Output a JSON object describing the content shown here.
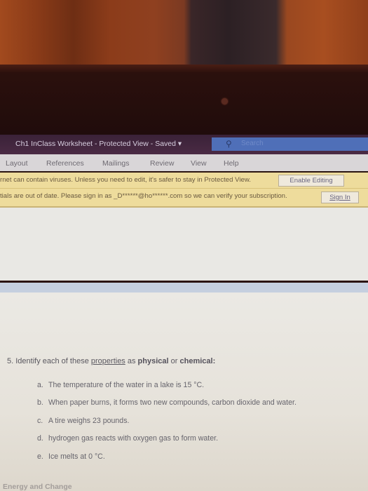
{
  "titlebar": {
    "title": "Ch1 InClass Worksheet  -  Protected View  -  Saved  ▾",
    "search_placeholder": "Search",
    "search_icon": "search-icon"
  },
  "ribbon": {
    "tabs": [
      "Layout",
      "References",
      "Mailings",
      "Review",
      "View",
      "Help"
    ]
  },
  "protected_bar": {
    "message": "rnet can contain viruses. Unless you need to edit, it's safer to stay in Protected View.",
    "button": "Enable Editing"
  },
  "signin_bar": {
    "message": "tials are out of date. Please sign in as _D******@ho******.com so we can verify your subscription.",
    "button": "Sign In"
  },
  "document": {
    "question_number": "5.",
    "question_pre": "Identify each of these ",
    "question_link": "properties",
    "question_mid": " as ",
    "question_bold1": "physical",
    "question_or": " or ",
    "question_bold2": "chemical",
    "question_end": ":",
    "items": [
      {
        "label": "a.",
        "text": "The temperature of the water in a lake is 15 °C."
      },
      {
        "label": "b.",
        "text": "When paper burns, it forms two new compounds, carbon dioxide and water."
      },
      {
        "label": "c.",
        "text": "A tire weighs 23 pounds."
      },
      {
        "label": "d.",
        "text": "hydrogen gas reacts with oxygen gas to form water."
      },
      {
        "label": "e.",
        "text": "Ice melts at 0 °C."
      }
    ],
    "next_heading": "Energy and Change"
  }
}
